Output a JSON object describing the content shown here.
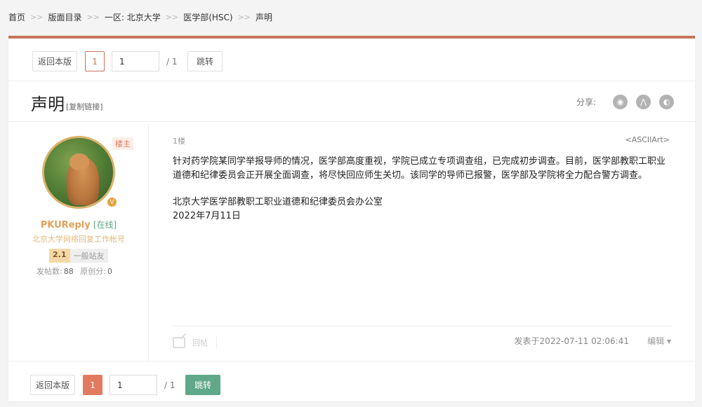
{
  "breadcrumb": {
    "items": [
      "首页",
      "版面目录",
      "一区: 北京大学",
      "医学部(HSC)",
      "声明"
    ],
    "separator": ">>"
  },
  "pager": {
    "back_label": "返回本版",
    "current_page": "1",
    "input_value": "1",
    "total": "/ 1",
    "jump_label": "跳转"
  },
  "header": {
    "title": "声明",
    "copy_link": "[复制链接]",
    "share_label": "分享:",
    "share_icons": [
      "weibo-icon",
      "renren-icon",
      "tencent-icon"
    ]
  },
  "user": {
    "owner_tag": "楼主",
    "name": "PKUReply",
    "status": "[在线]",
    "user_title": "北京大学网络回复工作帐号",
    "level": "2.1",
    "rank": "一般站友",
    "posts_label": "发帖数:",
    "posts": "88",
    "original_label": "原创分:",
    "original": "0",
    "badge": "V"
  },
  "post": {
    "floor": "1楼",
    "ascii_link": "<ASCIIArt>",
    "paragraph1": "针对药学院某同学举报导师的情况，医学部高度重视，学院已成立专项调查组，已完成初步调查。目前，医学部教职工职业道德和纪律委员会正开展全面调查，将尽快回应师生关切。该同学的导师已报警，医学部及学院将全力配合警方调查。",
    "signature": "北京大学医学部教职工职业道德和纪律委员会办公室",
    "date": "2022年7月11日",
    "reply_label": "回帖",
    "posted_at": "发表于2022-07-11 02:06:41",
    "edit_label": "编辑 ▾"
  },
  "colors": {
    "accent": "#c8745a",
    "jump_green": "#5fa889",
    "page_active": "#e27a60",
    "username": "#e2a05b"
  }
}
